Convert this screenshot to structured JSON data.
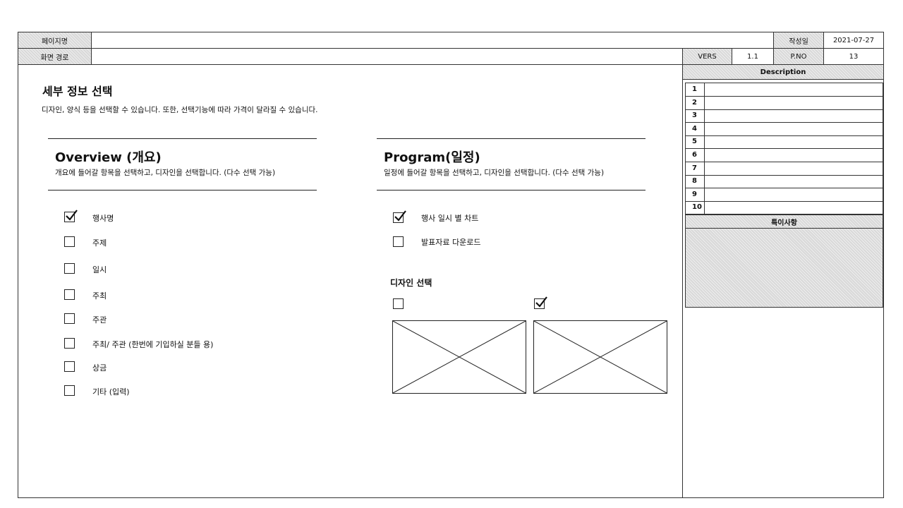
{
  "header": {
    "page_name_label": "페이지명",
    "page_name_value": "",
    "date_label": "작성일",
    "date_value": "2021-07-27",
    "path_label": "화면 경로",
    "path_value": "",
    "version_label": "VERS",
    "version_value": "1.1",
    "pno_label": "P.NO",
    "pno_value": "13"
  },
  "main": {
    "title": "세부 정보 선택",
    "subtitle": "디자인, 양식 등을 선택할 수 있습니다. 또한, 선택기능에 따라 가격이 달라질 수 있습니다.",
    "overview": {
      "title": "Overview (개요)",
      "description": "개요에 들어갈 항목을 선택하고, 디자인을 선택합니다. (다수 선택 가능)",
      "options": [
        {
          "label": "행사명",
          "checked": true
        },
        {
          "label": "주제",
          "checked": false
        },
        {
          "label": "일시",
          "checked": false
        },
        {
          "label": "주최",
          "checked": false
        },
        {
          "label": "주관",
          "checked": false
        },
        {
          "label": "주최/ 주관 (한번에 기입하실 분들 용)",
          "checked": false
        },
        {
          "label": "상금",
          "checked": false
        },
        {
          "label": "기타 (입력)",
          "checked": false
        }
      ]
    },
    "program": {
      "title": "Program(일정)",
      "description": "일정에 들어갈 항목을 선택하고, 디자인을 선택합니다. (다수 선택 가능)",
      "options": [
        {
          "label": "행사 일시 별 차트",
          "checked": true
        },
        {
          "label": "발표자료 다운로드",
          "checked": false
        }
      ],
      "design_title": "디자인 선택",
      "designs": [
        {
          "checked": false
        },
        {
          "checked": true
        }
      ]
    }
  },
  "sidebar": {
    "description_title": "Description",
    "rows": [
      "1",
      "2",
      "3",
      "4",
      "5",
      "6",
      "7",
      "8",
      "9",
      "10"
    ],
    "notes_title": "특이사항"
  }
}
